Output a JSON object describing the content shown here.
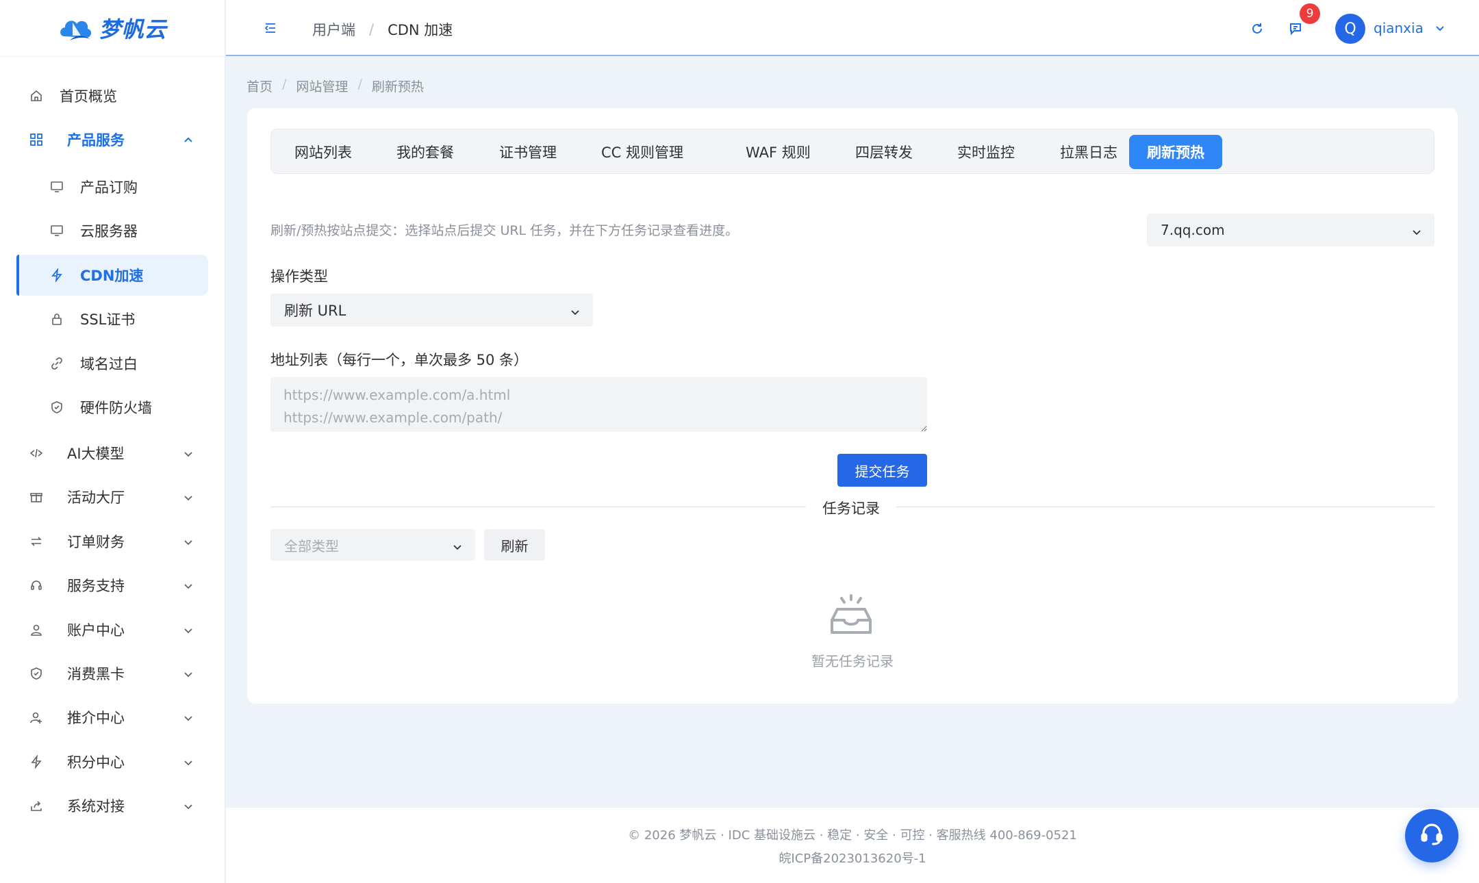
{
  "brand": {
    "name": "梦帆云",
    "colors": {
      "primary": "#2468e8",
      "accent": "#1f6fe5",
      "badge": "#ee3b3b"
    }
  },
  "sidebar": {
    "top": {
      "label": "首页概览",
      "icon": "home-icon"
    },
    "products": {
      "label": "产品服务",
      "icon": "grid-icon",
      "expanded": true,
      "items": [
        {
          "label": "产品订购",
          "icon": "monitor-icon"
        },
        {
          "label": "云服务器",
          "icon": "monitor-icon"
        },
        {
          "label": "CDN加速",
          "icon": "bolt-icon",
          "active": true
        },
        {
          "label": "SSL证书",
          "icon": "lock-icon"
        },
        {
          "label": "域名过白",
          "icon": "link-icon"
        },
        {
          "label": "硬件防火墙",
          "icon": "shield-icon"
        }
      ]
    },
    "groups": [
      {
        "label": "AI大模型",
        "icon": "code-icon"
      },
      {
        "label": "活动大厅",
        "icon": "gift-icon"
      },
      {
        "label": "订单财务",
        "icon": "exchange-icon"
      },
      {
        "label": "服务支持",
        "icon": "headset-icon"
      },
      {
        "label": "账户中心",
        "icon": "user-icon"
      },
      {
        "label": "消费黑卡",
        "icon": "shield-check-icon"
      },
      {
        "label": "推介中心",
        "icon": "user-plus-icon"
      },
      {
        "label": "积分中心",
        "icon": "bolt-icon"
      },
      {
        "label": "系统对接",
        "icon": "share-icon"
      }
    ]
  },
  "header": {
    "breadcrumb": [
      "用户端",
      "CDN 加速"
    ],
    "notifications_count": "9",
    "avatar_letter": "Q",
    "username": "qianxia"
  },
  "breadcrumb": [
    "首页",
    "网站管理",
    "刷新预热"
  ],
  "tabs": [
    "网站列表",
    "我的套餐",
    "证书管理",
    "CC 规则管理",
    "WAF 规则",
    "四层转发",
    "实时监控",
    "拉黑日志",
    "刷新预热"
  ],
  "active_tab": "刷新预热",
  "form": {
    "hint": "刷新/预热按站点提交：选择站点后提交 URL 任务，并在下方任务记录查看进度。",
    "site_value": "7.qq.com",
    "op_label": "操作类型",
    "op_value": "刷新 URL",
    "urls_label": "地址列表（每行一个，单次最多 50 条）",
    "urls_placeholder": "https://www.example.com/a.html\nhttps://www.example.com/path/",
    "submit_label": "提交任务"
  },
  "records": {
    "title": "任务记录",
    "type_placeholder": "全部类型",
    "refresh_label": "刷新",
    "empty_text": "暂无任务记录"
  },
  "footer": {
    "line1": "© 2026 梦帆云 · IDC 基础设施云 · 稳定 · 安全 · 可控 · 客服热线 400-869-0521",
    "line2": "皖ICP备2023013620号-1"
  }
}
